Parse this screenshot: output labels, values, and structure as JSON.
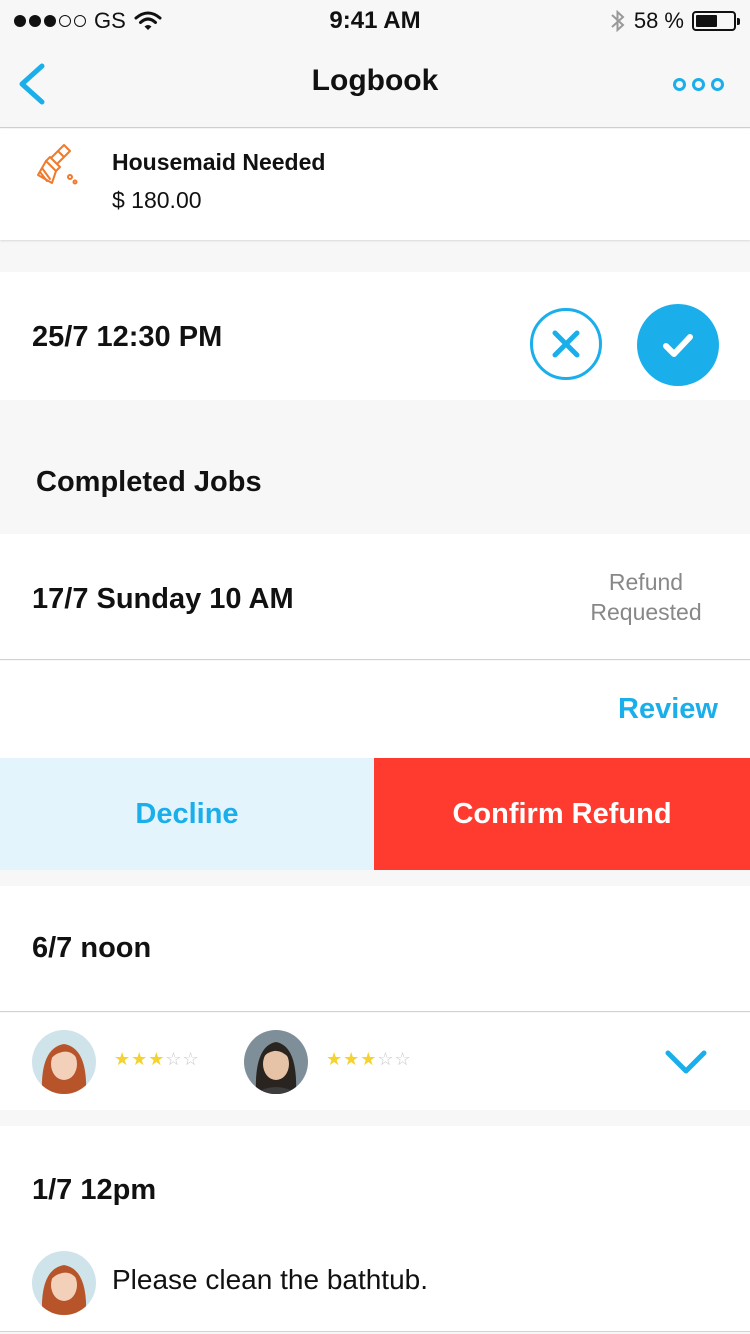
{
  "status_bar": {
    "carrier": "GS",
    "time": "9:41 AM",
    "battery_text": "58 %",
    "battery_level": 0.58,
    "signal_bars": 3,
    "signal_total": 5
  },
  "nav": {
    "title": "Logbook",
    "back_icon": "chevron-left-icon",
    "more_icon": "more-icon"
  },
  "job": {
    "icon": "broom-icon",
    "title": "Housemaid Needed",
    "price": "$ 180.00"
  },
  "pending": {
    "date": "25/7 12:30 PM"
  },
  "completed": {
    "section_title": "Completed Jobs",
    "entry1": {
      "date": "17/7 Sunday 10 AM",
      "status_line1": "Refund",
      "status_line2": "Requested",
      "review_label": "Review",
      "decline_label": "Decline",
      "confirm_label": "Confirm Refund"
    },
    "entry2": {
      "date": "6/7 noon",
      "ratings": [
        {
          "avatar": "avatar-redhead",
          "stars": 3,
          "max": 5
        },
        {
          "avatar": "avatar-darkhair",
          "stars": 3,
          "max": 5
        }
      ]
    },
    "entry3": {
      "date": "1/7 12pm",
      "comment": "Please clean the bathtub."
    }
  },
  "colors": {
    "accent": "#1aaeeb",
    "danger": "#ff3b30",
    "decline_bg": "#e3f4fc",
    "icon_orange": "#f07a2a",
    "star": "#f5d22e"
  }
}
